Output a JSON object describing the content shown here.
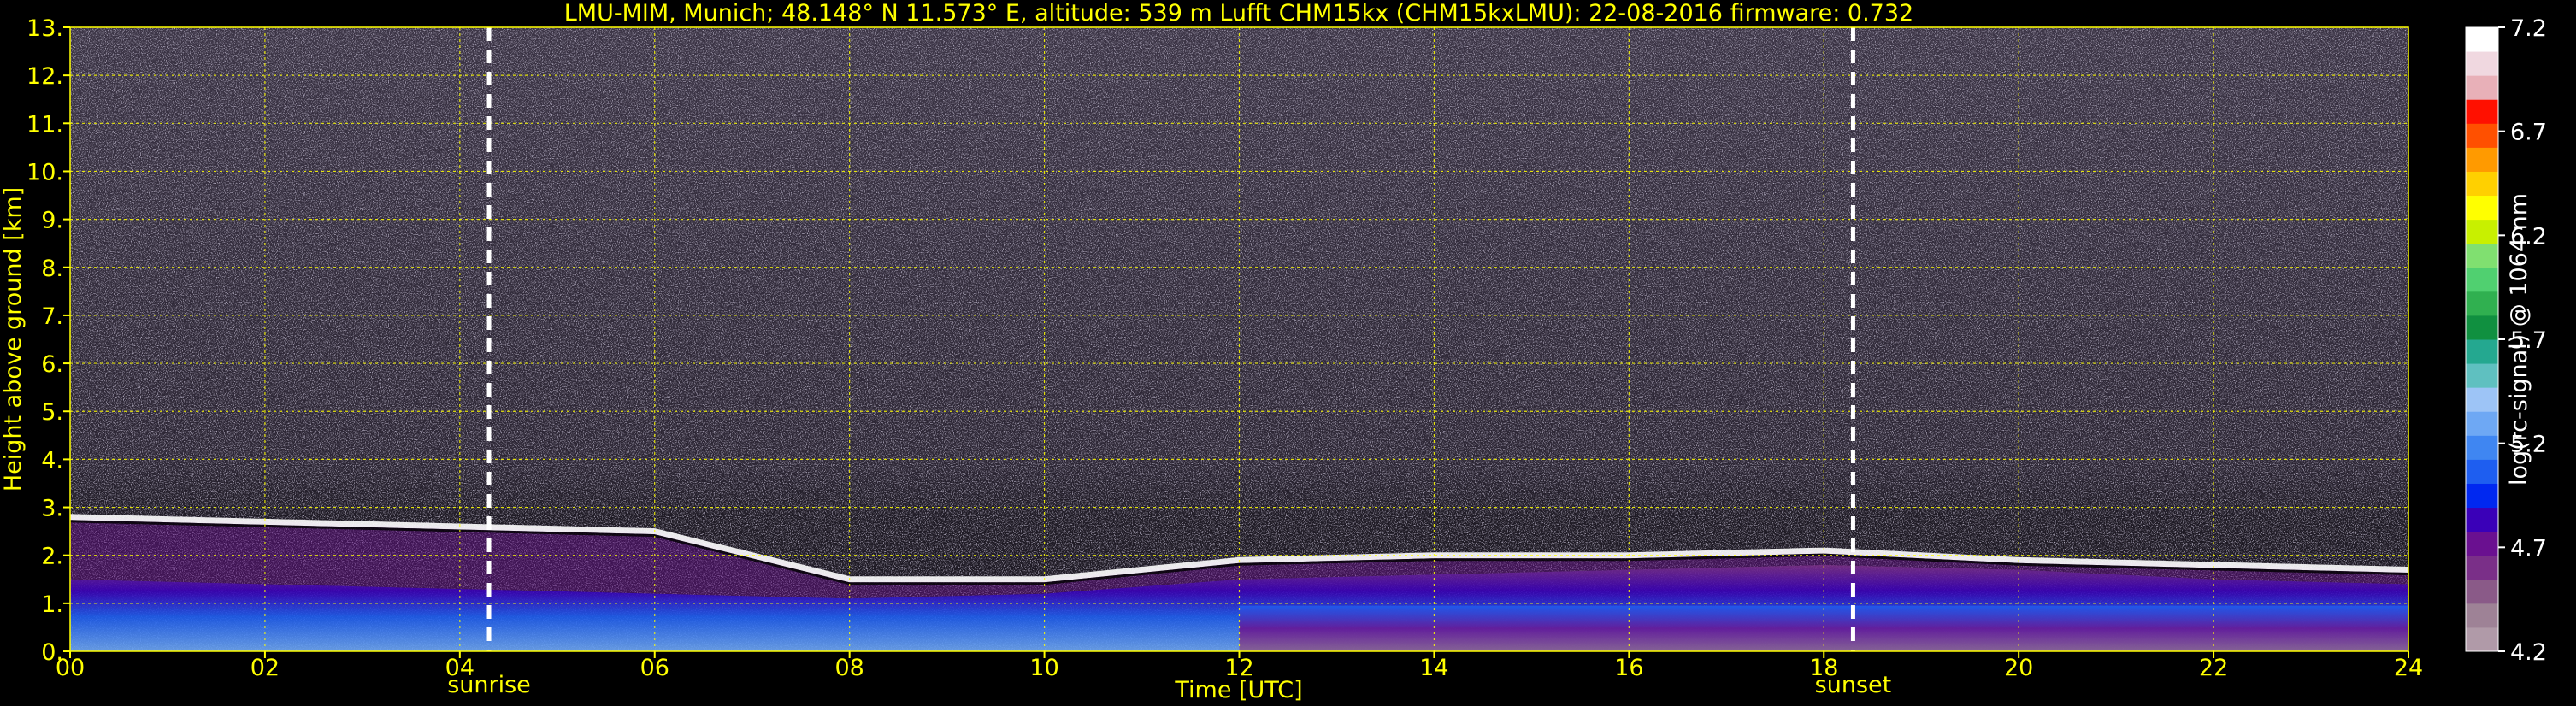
{
  "chart_data": {
    "type": "heatmap",
    "title": "LMU-MIM, Munich; 48.148° N 11.573° E, altitude: 539 m    Lufft CHM15kx (CHM15kxLMU): 22-08-2016    firmware: 0.732",
    "xlabel": "Time [UTC]",
    "ylabel": "Height above ground [km]",
    "xlim": [
      0,
      24
    ],
    "ylim": [
      0,
      13
    ],
    "x_ticks": [
      "00",
      "02",
      "04",
      "06",
      "08",
      "10",
      "12",
      "14",
      "16",
      "18",
      "20",
      "22",
      "24"
    ],
    "x_tick_values": [
      0,
      2,
      4,
      6,
      8,
      10,
      12,
      14,
      16,
      18,
      20,
      22,
      24
    ],
    "y_ticks": [
      "0.",
      "1.",
      "2.",
      "3.",
      "4.",
      "5.",
      "6.",
      "7.",
      "8.",
      "9.",
      "10.",
      "11.",
      "12.",
      "13."
    ],
    "y_tick_values": [
      0,
      1,
      2,
      3,
      4,
      5,
      6,
      7,
      8,
      9,
      10,
      11,
      12,
      13
    ],
    "grid": true,
    "markers": [
      {
        "label": "sunrise",
        "x": 4.3
      },
      {
        "label": "sunset",
        "x": 18.3
      }
    ],
    "colorbar": {
      "label": "log(rc-signal) @ 1064 nm",
      "ticks": [
        "4.2",
        "4.7",
        "5.2",
        "5.7",
        "6.2",
        "6.7",
        "7.2"
      ],
      "tick_values": [
        4.2,
        4.7,
        5.2,
        5.7,
        6.2,
        6.7,
        7.2
      ],
      "range": [
        4.2,
        7.2
      ],
      "colors": [
        "#b09aa8",
        "#9e8296",
        "#8a5a88",
        "#7a2f88",
        "#6a1090",
        "#3a00b8",
        "#0028f0",
        "#1e5ef0",
        "#3f86f2",
        "#6ea8f4",
        "#9dc4f6",
        "#5fc0c0",
        "#24a890",
        "#109040",
        "#30b050",
        "#50d070",
        "#80e070",
        "#c8f000",
        "#ffff00",
        "#ffd000",
        "#ff9a00",
        "#ff5000",
        "#ff1000",
        "#e8b0b8",
        "#f0d8e0",
        "#ffffff"
      ]
    },
    "features": [
      {
        "name": "boundary layer top",
        "x": [
          0,
          2,
          4,
          6,
          8,
          10,
          12,
          14,
          16,
          18,
          20,
          22,
          24
        ],
        "height_km": [
          2.8,
          2.7,
          2.6,
          2.5,
          1.5,
          1.5,
          1.9,
          2.0,
          2.0,
          2.1,
          1.9,
          1.8,
          1.7
        ]
      },
      {
        "name": "aerosol layer top",
        "x": [
          0,
          2,
          4,
          6,
          8,
          10,
          12,
          14,
          16,
          18,
          20,
          22,
          24
        ],
        "height_km": [
          1.5,
          1.4,
          1.3,
          1.2,
          1.1,
          1.2,
          1.5,
          1.6,
          1.7,
          1.8,
          1.7,
          1.5,
          1.4
        ]
      }
    ],
    "colors": {
      "text": "#ffff00",
      "grid": "#ffff00",
      "marker": "#ffffff",
      "background": "#000000"
    }
  }
}
